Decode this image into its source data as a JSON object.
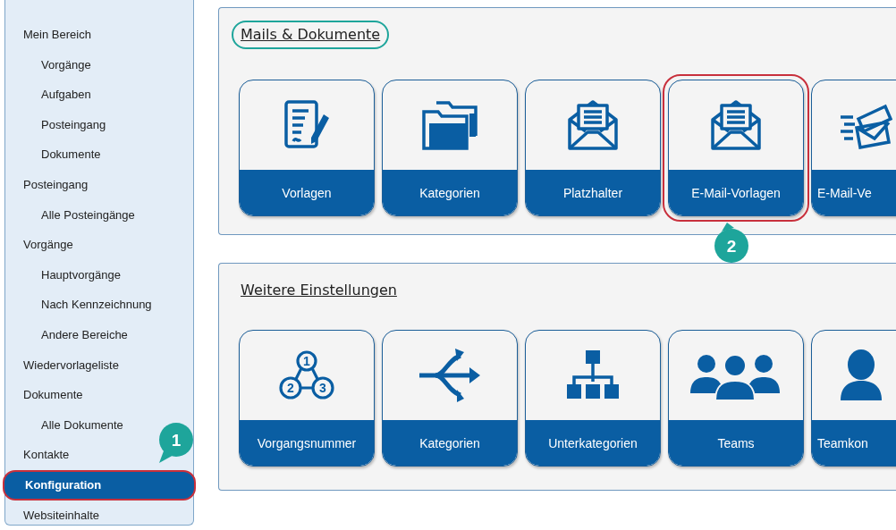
{
  "sidebar": {
    "items": [
      {
        "label": "Mein Bereich",
        "selected": false,
        "highlighted": false,
        "children": [
          {
            "label": "Vorgänge",
            "selected": false,
            "highlighted": false
          },
          {
            "label": "Aufgaben",
            "selected": false,
            "highlighted": false
          },
          {
            "label": "Posteingang",
            "selected": false,
            "highlighted": false
          },
          {
            "label": "Dokumente",
            "selected": false,
            "highlighted": false
          }
        ]
      },
      {
        "label": "Posteingang",
        "selected": false,
        "highlighted": false,
        "children": [
          {
            "label": "Alle Posteingänge",
            "selected": false,
            "highlighted": false
          }
        ]
      },
      {
        "label": "Vorgänge",
        "selected": false,
        "highlighted": false,
        "children": [
          {
            "label": "Hauptvorgänge",
            "selected": false,
            "highlighted": false
          },
          {
            "label": "Nach Kennzeichnung",
            "selected": false,
            "highlighted": false
          },
          {
            "label": "Andere Bereiche",
            "selected": false,
            "highlighted": false
          }
        ]
      },
      {
        "label": "Wiedervorlageliste",
        "selected": false,
        "highlighted": false
      },
      {
        "label": "Dokumente",
        "selected": false,
        "highlighted": false,
        "children": [
          {
            "label": "Alle Dokumente",
            "selected": false,
            "highlighted": false
          }
        ]
      },
      {
        "label": "Kontakte",
        "selected": false,
        "highlighted": false
      },
      {
        "label": "Konfiguration",
        "selected": true,
        "highlighted": true,
        "callout": "1"
      },
      {
        "label": "Websiteinhalte",
        "selected": false,
        "highlighted": false
      }
    ]
  },
  "sections": [
    {
      "title": "Mails & Dokumente",
      "circled": true,
      "tiles": [
        {
          "label": "Vorlagen",
          "kind": "document",
          "highlighted": false,
          "cut": false
        },
        {
          "label": "Kategorien",
          "kind": "folder",
          "highlighted": false,
          "cut": false
        },
        {
          "label": "Platzhalter",
          "kind": "envelope",
          "highlighted": false,
          "cut": false
        },
        {
          "label": "E-Mail-Vorlagen",
          "kind": "envelope",
          "highlighted": true,
          "cut": false,
          "callout": "2"
        },
        {
          "label": "E-Mail-Ve",
          "kind": "mail-stack",
          "highlighted": false,
          "cut": true
        }
      ]
    },
    {
      "title": "Weitere Einstellungen",
      "circled": false,
      "tiles": [
        {
          "label": "Vorgangsnummer",
          "kind": "numbers",
          "icon_text": [
            "1",
            "2",
            "3"
          ],
          "highlighted": false,
          "cut": false
        },
        {
          "label": "Kategorien",
          "kind": "arrows",
          "highlighted": false,
          "cut": false
        },
        {
          "label": "Unterkategorien",
          "kind": "hierarchy",
          "highlighted": false,
          "cut": false
        },
        {
          "label": "Teams",
          "kind": "team",
          "highlighted": false,
          "cut": false
        },
        {
          "label": "Teamkon",
          "kind": "person",
          "highlighted": false,
          "cut": true
        }
      ]
    }
  ]
}
